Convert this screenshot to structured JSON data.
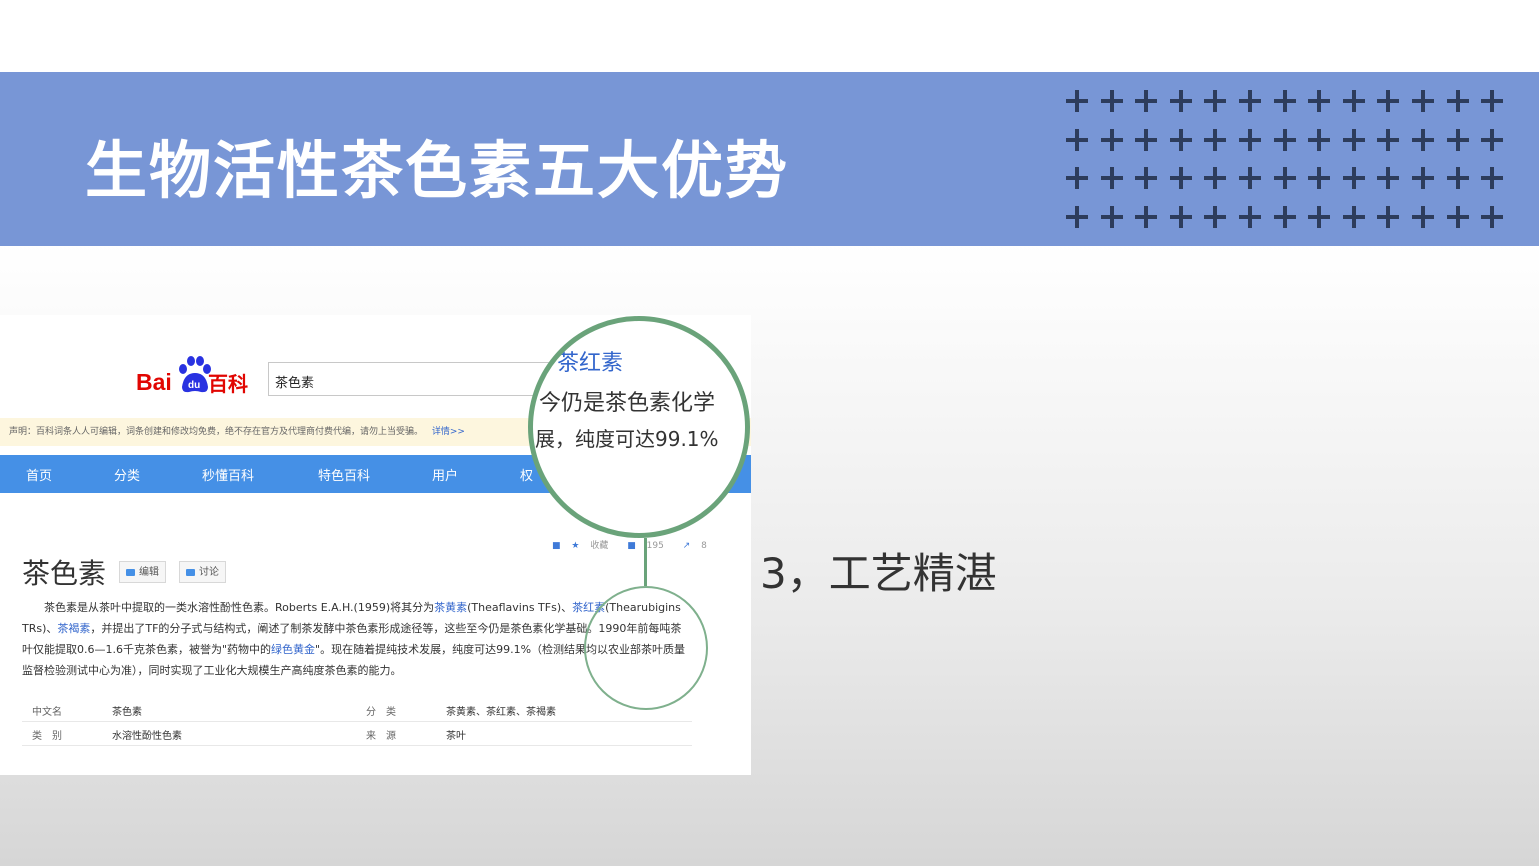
{
  "slide": {
    "title": "生物活性茶色素五大优势",
    "point": "3，工艺精湛"
  },
  "colors": {
    "banner": "#7896d6",
    "plus_marks": "#2d3c5c",
    "highlight_ring": "#6aa37a",
    "baidu_nav": "#4590e6"
  },
  "screenshot": {
    "logo": {
      "bai": "Bai",
      "du": "du",
      "baike": "百科"
    },
    "search_value": "茶色素",
    "notice": "声明：百科词条人人可编辑，词条创建和修改均免费，绝不存在官方及代理商付费代编，请勿上当受骗。",
    "notice_link": "详情>>",
    "nav": [
      "首页",
      "分类",
      "秒懂百科",
      "特色百科",
      "用户",
      "权"
    ],
    "entry_title": "茶色素",
    "edit_btn": "编辑",
    "discuss_btn": "讨论",
    "tools": {
      "collect": "收藏",
      "likes": "195",
      "share": "8"
    },
    "para": {
      "p1": "茶色素是从茶叶中提取的一类水溶性酚性色素。Roberts E.A.H.(1959)将其分为",
      "l1": "茶黄素",
      "p2": "(Theaflavins TFs)、",
      "l2": "茶红素",
      "p3": "(Thearubigins TRs)、",
      "l3": "茶褐素",
      "p4": "，并提出了TF的分子式与结构式，阐述了制茶发酵中茶色素形成途径等，这些至今仍是茶色素化学基础。1990年前每吨茶叶仅能提取0.6—1.6千克茶色素，被誉为\"药物中的",
      "l4": "绿色黄金",
      "p5": "\"。现在随着提纯技术发展，纯度可达99.1%（检测结果均以农业部茶叶质量监督检验测试中心为准），同时实现了工业化大规模生产高纯度茶色素的能力。"
    },
    "info": [
      {
        "label1": "中文名",
        "value1": "茶色素",
        "label2": "分　类",
        "value2": "茶黄素、茶红素、茶褐素"
      },
      {
        "label1": "类　别",
        "value1": "水溶性酚性色素",
        "label2": "来　源",
        "value2": "茶叶"
      }
    ],
    "zoom": {
      "line1": "茶红素",
      "line2": "今仍是茶色素化学",
      "line3": "展，纯度可达99.1%"
    }
  }
}
